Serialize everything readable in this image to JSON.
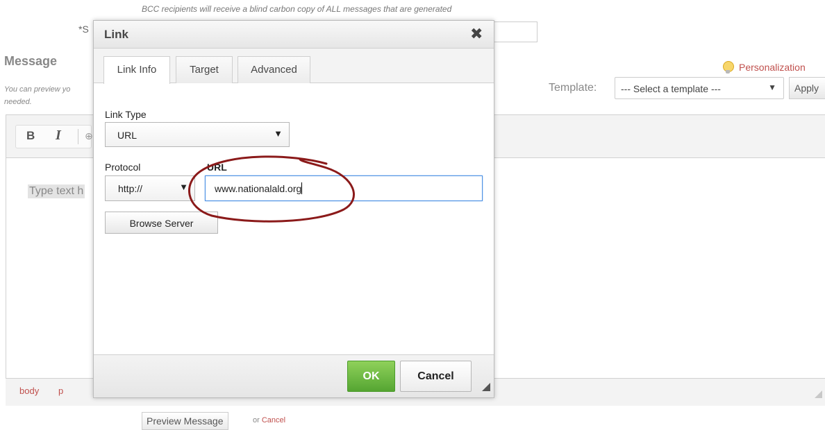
{
  "page": {
    "bcc_note": "BCC recipients will receive a blind carbon copy of ALL messages that are generated",
    "subject_label": "*S",
    "message_heading": "Message",
    "message_desc_line1": "You can preview yo",
    "message_desc_line2": "needed.",
    "personalization_label": "Personalization",
    "template_label": "Template:",
    "template_select_value": "--- Select a template ---",
    "apply_label": "Apply",
    "editor": {
      "bold_label": "B",
      "italic_label": "I",
      "placeholder_text": "Type text h",
      "path_body": "body",
      "path_p": "p"
    },
    "preview_button_label": "Preview Message",
    "or_text": "or",
    "cancel_link": "Cancel"
  },
  "dialog": {
    "title": "Link",
    "close_glyph": "✖",
    "tabs": [
      {
        "label": "Link Info",
        "active": true
      },
      {
        "label": "Target",
        "active": false
      },
      {
        "label": "Advanced",
        "active": false
      }
    ],
    "link_type_label": "Link Type",
    "link_type_value": "URL",
    "protocol_label": "Protocol",
    "protocol_value": "http://",
    "url_label": "URL",
    "url_value": "www.nationalald.org",
    "browse_server_label": "Browse Server",
    "ok_label": "OK",
    "cancel_label": "Cancel",
    "dropdown_arrow": "▼"
  },
  "colors": {
    "accent_red": "#c0504d",
    "ok_green": "#5cb53a",
    "focus_blue": "#4a8fe3",
    "annotation_circle": "#8b1a1a"
  },
  "icons": {
    "personalization": "lightbulb-icon",
    "close": "close-icon",
    "dropdown": "chevron-down-icon",
    "resize": "resize-grip-icon"
  }
}
